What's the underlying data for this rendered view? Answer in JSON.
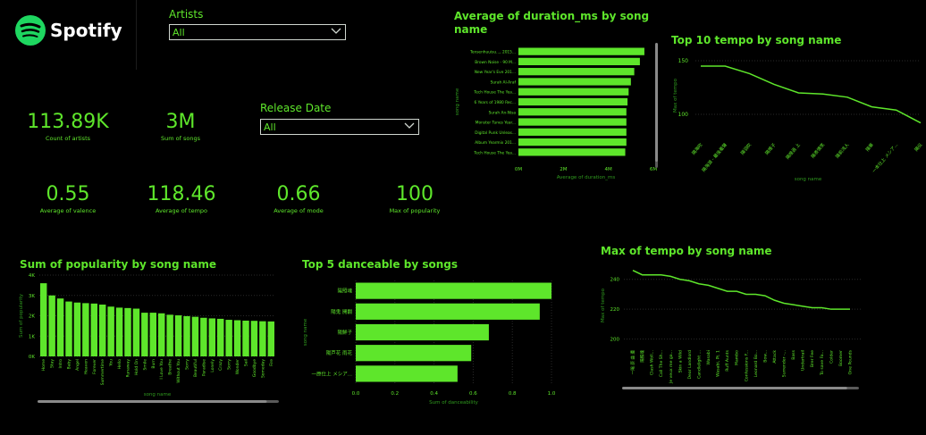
{
  "brand": {
    "name": "Spotify",
    "color": "#1ed760"
  },
  "colors": {
    "accent": "#5ee62b",
    "background": "#000000",
    "axis_text": "#2f9a1e"
  },
  "filters": {
    "artists": {
      "label": "Artists",
      "value": "All"
    },
    "release_date": {
      "label": "Release Date",
      "value": "All"
    }
  },
  "kpis": [
    {
      "value": "113.89K",
      "label": "Count of artists"
    },
    {
      "value": "3M",
      "label": "Sum of songs"
    },
    {
      "value": "0.55",
      "label": "Average of valence"
    },
    {
      "value": "118.46",
      "label": "Average of tempo"
    },
    {
      "value": "0.66",
      "label": "Average of mode"
    },
    {
      "value": "100",
      "label": "Max of popularity"
    }
  ],
  "chart_data": [
    {
      "id": "duration",
      "type": "bar",
      "orientation": "horizontal",
      "title": "Average of duration_ms by song name",
      "xlabel": "Average of duration_ms",
      "ylabel": "song name",
      "categories": [
        "Tensenhuuisu..., 2015...",
        "Brown Noise - 90 M...",
        "New Year's Eve 201...",
        "Surah Al-Araf",
        "Tech House The Yea...",
        "6 Years of 1980 Rec...",
        "Surah An-Nisa",
        "Monster Tunes Year...",
        "Digital Punk Unleas...",
        "Album Yearmix 201...",
        "Tech House The Yea..."
      ],
      "values": [
        5.6,
        5.4,
        5.15,
        5.0,
        4.9,
        4.85,
        4.8,
        4.8,
        4.8,
        4.8,
        4.75
      ],
      "xlim": [
        0,
        6
      ],
      "xticks": [
        "0M",
        "2M",
        "4M",
        "6M"
      ]
    },
    {
      "id": "tempo_top10",
      "type": "line",
      "title": "Top 10 tempo by song name",
      "xlabel": "song name",
      "ylabel": "Max of tempo",
      "categories": [
        "陽海吹",
        "陽海湖 - 最後羞聲",
        "陽羽吹",
        "陽煌子",
        "陽煌過 上",
        "陽表情笑",
        "陽前浅人",
        "陽華",
        "一本仕上 メシア...",
        "陽伝"
      ],
      "values": [
        145,
        145,
        138,
        128,
        120,
        119,
        116,
        107,
        104,
        92
      ],
      "ylim": [
        80,
        155
      ],
      "yticks": [
        100,
        150
      ]
    },
    {
      "id": "popularity",
      "type": "bar",
      "title": "Sum of popularity by song name",
      "xlabel": "song name",
      "ylabel": "Sum of popularity",
      "categories": [
        "Home",
        "Stay",
        "Intro",
        "Baby",
        "Angel",
        "Heaven",
        "Forever",
        "Summertime",
        "You",
        "Hello",
        "Runaway",
        "Hold On",
        "Smile",
        "Burn",
        "I Love You",
        "Breathe",
        "Without You",
        "Sorry",
        "Beautiful",
        "Paradise",
        "Lonely",
        "Crazy",
        "Sorry",
        "Wonder",
        "Sail",
        "Goodbye",
        "Someday",
        "Fire"
      ],
      "values": [
        3600,
        3000,
        2850,
        2700,
        2650,
        2620,
        2600,
        2550,
        2450,
        2400,
        2380,
        2350,
        2150,
        2150,
        2120,
        2050,
        2020,
        1980,
        1950,
        1900,
        1870,
        1850,
        1800,
        1780,
        1760,
        1750,
        1730,
        1720
      ],
      "ylim": [
        0,
        4000
      ],
      "yticks": [
        "0K",
        "1K",
        "2K",
        "3K",
        "4K"
      ]
    },
    {
      "id": "danceable",
      "type": "bar",
      "orientation": "horizontal",
      "title": "Top 5 danceable by songs",
      "xlabel": "Sum of danceability",
      "ylabel": "song name",
      "categories": [
        "陽照魂",
        "陽鬼 開闢",
        "陽鮮子",
        "陽芦花 雨花",
        "一原仕上 メシア..."
      ],
      "values": [
        1.0,
        0.94,
        0.68,
        0.59,
        0.52
      ],
      "xlim": [
        0,
        1
      ],
      "xticks": [
        "0.0",
        "0.2",
        "0.4",
        "0.6",
        "0.8",
        "1.0"
      ]
    },
    {
      "id": "tempo_max",
      "type": "line",
      "title": "Max of tempo by song name",
      "xlabel": "song name",
      "ylabel": "Max of tempo",
      "categories": [
        "一陽 原 曲 遭",
        "陽照魂",
        "Clash Woll...",
        "Call The Sh...",
        "Je veux me ga...",
        "Skin a Wild",
        "Dear Landlord",
        "Candlelight ...",
        "Wasabi",
        "Wasabi, Pt. 1",
        "Ruff Aunts",
        "Mambo",
        "Confessions F...",
        "Leonard Bo...",
        "Bow...",
        "Attack",
        "Surrender -...",
        "Bass",
        "Undertrail",
        "Brer Fee",
        "To save Fa...",
        "Colder",
        "Boomer",
        "One Pounds"
      ],
      "values": [
        246,
        243,
        243,
        243,
        242,
        240,
        239,
        237,
        236,
        234,
        232,
        232,
        230,
        230,
        229,
        226,
        224,
        223,
        222,
        221,
        221,
        220,
        220,
        220
      ],
      "ylim": [
        195,
        250
      ],
      "yticks": [
        200,
        220,
        240
      ]
    }
  ]
}
